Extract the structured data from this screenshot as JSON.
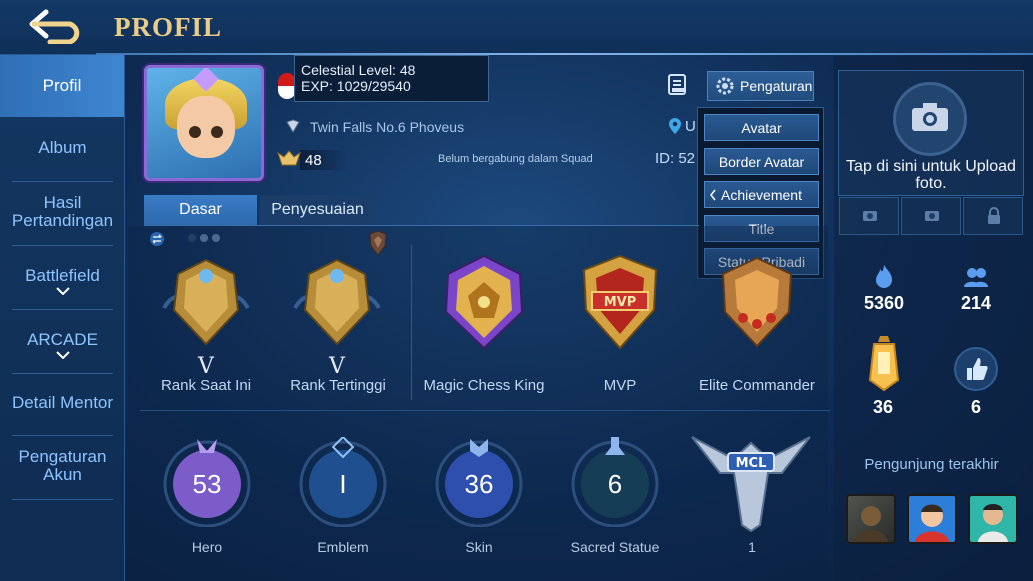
{
  "header": {
    "title": "PROFIL"
  },
  "sidebar": {
    "items": [
      {
        "label": "Profil"
      },
      {
        "label": "Album"
      },
      {
        "label": "Hasil Pertandingan"
      },
      {
        "label": "Battlefield"
      },
      {
        "label": "ARCADE"
      },
      {
        "label": "Detail Mentor"
      },
      {
        "label": "Pengaturan Akun"
      }
    ]
  },
  "profile": {
    "tooltip_line1": "Celestial Level: 48",
    "tooltip_line2": "EXP: 1029/29540",
    "title": "Twin Falls No.6 Phoveus",
    "level": "48",
    "squad": "Belum bergabung dalam Squad",
    "id_text": "ID: 52",
    "location_text": "U"
  },
  "settings": {
    "button_label": "Pengaturan",
    "menu": [
      "Avatar",
      "Border Avatar",
      "Achievement",
      "Title",
      "Status Pribadi"
    ]
  },
  "tabs": {
    "dasar": "Dasar",
    "penyesuaian": "Penyesuaian"
  },
  "medals": [
    {
      "label": "Rank Saat Ini",
      "tier": "V"
    },
    {
      "label": "Rank Tertinggi",
      "tier": "V"
    },
    {
      "label": "Magic Chess King"
    },
    {
      "label": "MVP",
      "badge_text": "MVP"
    },
    {
      "label": "Elite Commander"
    }
  ],
  "stats": [
    {
      "label": "Hero",
      "value": "53",
      "color": "#7b5cc8"
    },
    {
      "label": "Emblem",
      "value": "I",
      "color": "#2f6fc0"
    },
    {
      "label": "Skin",
      "value": "36",
      "color": "#3d5fc2"
    },
    {
      "label": "Sacred Statue",
      "value": "6",
      "color": "#2a6d6a"
    },
    {
      "label": "1",
      "badge_text": "MCL"
    }
  ],
  "right_panel": {
    "upload_text": "Tap di sini untuk Upload foto.",
    "popularity": "5360",
    "followers": "214",
    "lantern": "36",
    "likes": "6",
    "visitors_title": "Pengunjung terakhir"
  },
  "colors": {
    "accent_gold": "#e8cc88",
    "sidebar_active": "#3f86d1",
    "text_blue": "#8ec4ff"
  }
}
